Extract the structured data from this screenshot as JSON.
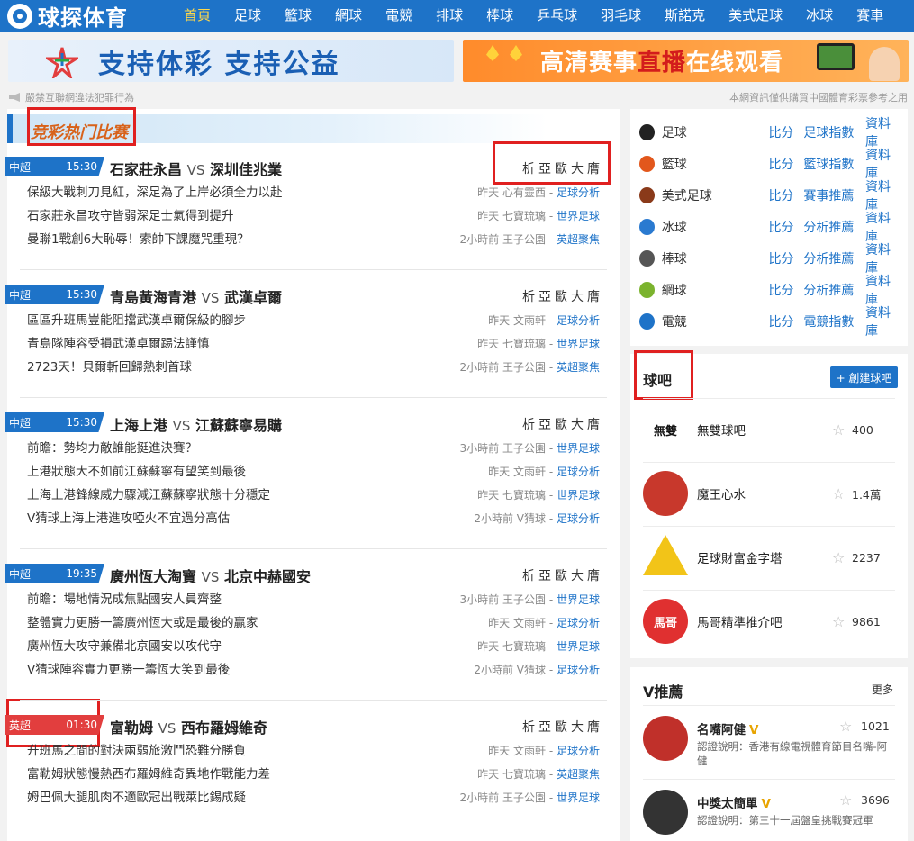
{
  "site": {
    "logo_text": "球探体育"
  },
  "nav": [
    "首頁",
    "足球",
    "籃球",
    "網球",
    "電競",
    "排球",
    "棒球",
    "乒乓球",
    "羽毛球",
    "斯諾克",
    "美式足球",
    "冰球",
    "賽車"
  ],
  "banners": {
    "left_text": "支持体彩  支持公益",
    "right_text_a": "高清赛事",
    "right_text_b": "直播",
    "right_text_c": "在线观看"
  },
  "notice": {
    "left": "嚴禁互聯網違法犯罪行為",
    "right": "本網資訊僅供購買中國體育彩票參考之用"
  },
  "section_title": "竞彩热门比赛",
  "matches": [
    {
      "league": "中超",
      "time": "15:30",
      "home": "石家莊永昌",
      "vs": "VS",
      "away": "深圳佳兆業",
      "links": [
        "析",
        "亞",
        "歐",
        "大",
        "膺"
      ],
      "news": [
        {
          "text": "保級大戰刺刀見紅，深足為了上岸必須全力以赴",
          "when": "昨天",
          "author": "心有靈西",
          "cat": "足球分析"
        },
        {
          "text": "石家莊永昌攻守皆弱深足士氣得到提升",
          "when": "昨天",
          "author": "七寶琉璃",
          "cat": "世界足球"
        },
        {
          "text": "曼聯1戰創6大恥辱！索帥下課魔咒重現？",
          "when": "2小時前",
          "author": "王子公園",
          "cat": "英超聚焦"
        }
      ]
    },
    {
      "league": "中超",
      "time": "15:30",
      "home": "青島黃海青港",
      "vs": "VS",
      "away": "武漢卓爾",
      "links": [
        "析",
        "亞",
        "歐",
        "大",
        "膺"
      ],
      "news": [
        {
          "text": "區區升班馬豈能阻擋武漢卓爾保級的腳步",
          "when": "昨天",
          "author": "文雨軒",
          "cat": "足球分析"
        },
        {
          "text": "青島隊陣容受損武漢卓爾踢法謹慎",
          "when": "昨天",
          "author": "七寶琉璃",
          "cat": "世界足球"
        },
        {
          "text": "2723天！貝爾斬回歸熱刺首球",
          "when": "2小時前",
          "author": "王子公園",
          "cat": "英超聚焦"
        }
      ]
    },
    {
      "league": "中超",
      "time": "15:30",
      "home": "上海上港",
      "vs": "VS",
      "away": "江蘇蘇寧易購",
      "links": [
        "析",
        "亞",
        "歐",
        "大",
        "膺"
      ],
      "news": [
        {
          "text": "前瞻：勢均力敵誰能挺進決賽？",
          "when": "3小時前",
          "author": "王子公園",
          "cat": "世界足球"
        },
        {
          "text": "上港狀態大不如前江蘇蘇寧有望笑到最後",
          "when": "昨天",
          "author": "文雨軒",
          "cat": "足球分析"
        },
        {
          "text": "上海上港鋒線威力驟減江蘇蘇寧狀態十分穩定",
          "when": "昨天",
          "author": "七寶琉璃",
          "cat": "世界足球"
        },
        {
          "text": "V猜球上海上港進攻啞火不宜過分高估",
          "when": "2小時前",
          "author": "V猜球",
          "cat": "足球分析"
        }
      ]
    },
    {
      "league": "中超",
      "time": "19:35",
      "home": "廣州恆大淘寶",
      "vs": "VS",
      "away": "北京中赫國安",
      "links": [
        "析",
        "亞",
        "歐",
        "大",
        "膺"
      ],
      "news": [
        {
          "text": "前瞻：場地情況成焦點國安人員齊整",
          "when": "3小時前",
          "author": "王子公園",
          "cat": "世界足球"
        },
        {
          "text": "整體實力更勝一籌廣州恆大或是最後的贏家",
          "when": "昨天",
          "author": "文雨軒",
          "cat": "足球分析"
        },
        {
          "text": "廣州恆大攻守兼備北京國安以攻代守",
          "when": "昨天",
          "author": "七寶琉璃",
          "cat": "世界足球"
        },
        {
          "text": "V猜球陣容實力更勝一籌恆大笑到最後",
          "when": "2小時前",
          "author": "V猜球",
          "cat": "足球分析"
        }
      ]
    },
    {
      "league": "英超",
      "time": "01:30",
      "home": "富勒姆",
      "vs": "VS",
      "away": "西布羅姆維奇",
      "links": [
        "析",
        "亞",
        "歐",
        "大",
        "膺"
      ],
      "red": true,
      "news": [
        {
          "text": "升班馬之間的對決兩弱旅激鬥恐難分勝負",
          "when": "昨天",
          "author": "文雨軒",
          "cat": "足球分析"
        },
        {
          "text": "富勒姆狀態慢熱西布羅姆維奇異地作戰能力差",
          "when": "昨天",
          "author": "七寶琉璃",
          "cat": "英超聚焦"
        },
        {
          "text": "姆巴佩大腿肌肉不適歐冠出戰萊比錫成疑",
          "when": "2小時前",
          "author": "王子公園",
          "cat": "世界足球"
        }
      ]
    }
  ],
  "sports": [
    {
      "name": "足球",
      "l1": "比分",
      "l2": "足球指數",
      "l3": "資料庫",
      "color": "#222222"
    },
    {
      "name": "籃球",
      "l1": "比分",
      "l2": "籃球指數",
      "l3": "資料庫",
      "color": "#e2571c"
    },
    {
      "name": "美式足球",
      "l1": "比分",
      "l2": "賽事推薦",
      "l3": "資料庫",
      "color": "#8a3a1a"
    },
    {
      "name": "冰球",
      "l1": "比分",
      "l2": "分析推薦",
      "l3": "資料庫",
      "color": "#2a7ad0"
    },
    {
      "name": "棒球",
      "l1": "比分",
      "l2": "分析推薦",
      "l3": "資料庫",
      "color": "#555555"
    },
    {
      "name": "網球",
      "l1": "比分",
      "l2": "分析推薦",
      "l3": "資料庫",
      "color": "#7bb32e"
    },
    {
      "name": "電競",
      "l1": "比分",
      "l2": "電競指數",
      "l3": "資料庫",
      "color": "#1e73c8"
    }
  ],
  "ball_bar": {
    "title": "球吧",
    "create_label": "+ 創建球吧",
    "items": [
      {
        "name": "無雙球吧",
        "count": "400",
        "avatar_text": "無雙",
        "color": "#ffffff"
      },
      {
        "name": "魔王心水",
        "count": "1.4萬",
        "color": "#c8382c"
      },
      {
        "name": "足球財富金字塔",
        "count": "2237",
        "color": "#f2c418"
      },
      {
        "name": "馬哥精準推介吧",
        "count": "9861",
        "avatar_text": "馬哥",
        "color": "#e03030"
      }
    ]
  },
  "vrec": {
    "title": "V推薦",
    "more": "更多",
    "items": [
      {
        "name": "名嘴阿健",
        "badge": "V",
        "count": "1021",
        "desc": "認證說明：香港有線電視體育節目名嘴-阿健",
        "color": "#c0302a"
      },
      {
        "name": "中獎太簡單",
        "badge": "V",
        "count": "3696",
        "desc": "認證說明：第三十一屆盤皇挑戰賽冠軍",
        "color": "#333333"
      }
    ]
  }
}
